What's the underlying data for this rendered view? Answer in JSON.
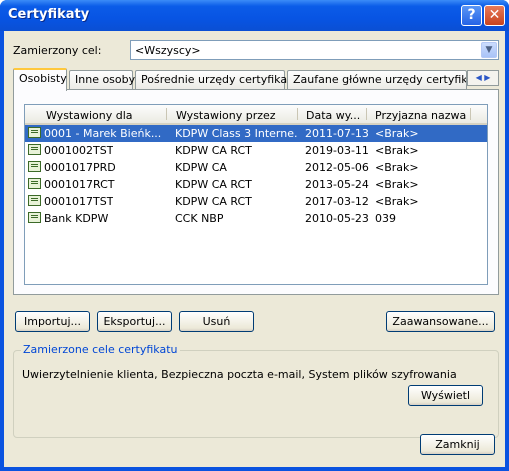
{
  "window": {
    "title": "Certyfikaty"
  },
  "purpose": {
    "label": "Zamierzony cel:",
    "selected": "<Wszyscy>"
  },
  "tabs": [
    {
      "label": "Osobisty"
    },
    {
      "label": "Inne osoby"
    },
    {
      "label": "Pośrednie urzędy certyfikacji"
    },
    {
      "label": "Zaufane główne urzędy certyfikacji"
    }
  ],
  "table": {
    "columns": [
      "Wystawiony dla",
      "Wystawiony przez",
      "Data wy...",
      "Przyjazna nazwa"
    ],
    "rows": [
      {
        "issued_to": "0001 - Marek Bieńk...",
        "issued_by": "KDPW Class 3 Interne...",
        "date": "2011-07-13",
        "friendly": "<Brak>"
      },
      {
        "issued_to": "0001002TST",
        "issued_by": "KDPW CA RCT",
        "date": "2019-03-11",
        "friendly": "<Brak>"
      },
      {
        "issued_to": "0001017PRD",
        "issued_by": "KDPW CA",
        "date": "2012-05-06",
        "friendly": "<Brak>"
      },
      {
        "issued_to": "0001017RCT",
        "issued_by": "KDPW CA RCT",
        "date": "2013-05-24",
        "friendly": "<Brak>"
      },
      {
        "issued_to": "0001017TST",
        "issued_by": "KDPW CA RCT",
        "date": "2017-03-12",
        "friendly": "<Brak>"
      },
      {
        "issued_to": "Bank KDPW",
        "issued_by": "CCK NBP",
        "date": "2010-05-23",
        "friendly": "039"
      }
    ]
  },
  "buttons": {
    "import": "Importuj...",
    "export": "Eksportuj...",
    "remove": "Usuń",
    "advanced": "Zaawansowane...",
    "view": "Wyświetl",
    "close": "Zamknij"
  },
  "purposes_group": {
    "title": "Zamierzone cele certyfikatu",
    "text": "Uwierzytelnienie klienta, Bezpieczna poczta e-mail, System plików szyfrowania"
  }
}
